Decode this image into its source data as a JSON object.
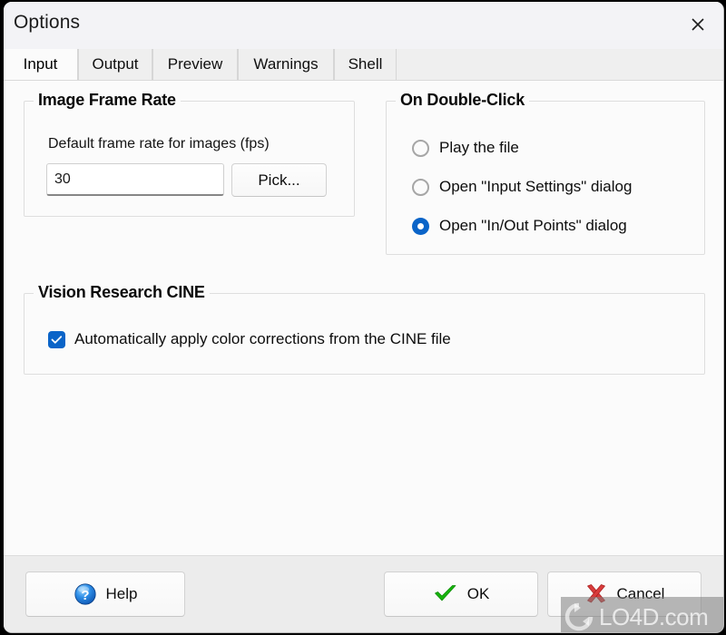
{
  "window": {
    "title": "Options",
    "close_icon": "close-icon"
  },
  "tabs": [
    {
      "label": "Input",
      "active": true
    },
    {
      "label": "Output",
      "active": false
    },
    {
      "label": "Preview",
      "active": false
    },
    {
      "label": "Warnings",
      "active": false
    },
    {
      "label": "Shell",
      "active": false
    }
  ],
  "frame_rate_group": {
    "title": "Image Frame Rate",
    "field_label": "Default frame rate for images (fps)",
    "input_value": "30",
    "input_placeholder": "",
    "pick_button": "Pick..."
  },
  "double_click_group": {
    "title": "On Double-Click",
    "options": [
      {
        "label": "Play the file",
        "selected": false
      },
      {
        "label": "Open \"Input Settings\" dialog",
        "selected": false
      },
      {
        "label": "Open \"In/Out Points\" dialog",
        "selected": true
      }
    ]
  },
  "cine_group": {
    "title": "Vision Research CINE",
    "checkbox_label": "Automatically apply color corrections from the CINE file",
    "checkbox_checked": true
  },
  "footer": {
    "help_button": "Help",
    "help_icon": "question-mark-icon",
    "ok_button": "OK",
    "ok_icon": "green-check-icon",
    "cancel_button": "Cancel",
    "cancel_icon": "red-x-icon"
  },
  "watermark": {
    "text": "LO4D.com",
    "icon": "circular-arrows-icon"
  },
  "colors": {
    "accent_blue": "#0a64c8",
    "ok_green": "#14b414",
    "cancel_red": "#d62828",
    "title_bar": "#f3f3f6",
    "content_bg": "#fbfbfb",
    "footer_bg": "#ececec"
  }
}
